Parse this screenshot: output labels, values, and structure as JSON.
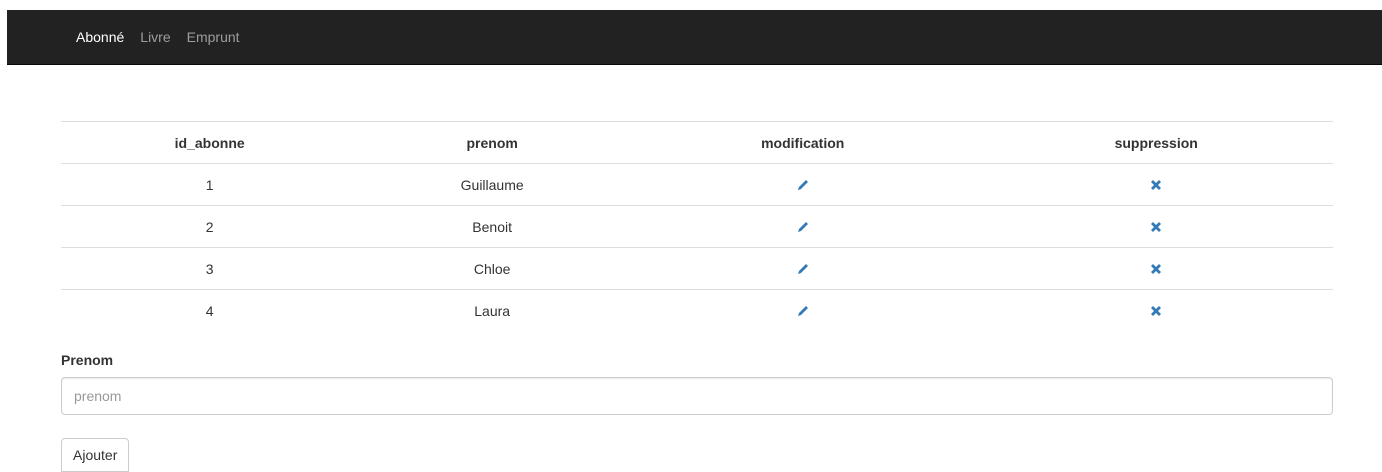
{
  "navbar": {
    "items": [
      {
        "label": "Abonné",
        "active": true
      },
      {
        "label": "Livre",
        "active": false
      },
      {
        "label": "Emprunt",
        "active": false
      }
    ]
  },
  "table": {
    "headers": [
      "id_abonne",
      "prenom",
      "modification",
      "suppression"
    ],
    "rows": [
      {
        "id": "1",
        "prenom": "Guillaume",
        "edit_icon": "pencil-icon",
        "delete_icon": "remove-icon"
      },
      {
        "id": "2",
        "prenom": "Benoit",
        "edit_icon": "pencil-icon",
        "delete_icon": "remove-icon"
      },
      {
        "id": "3",
        "prenom": "Chloe",
        "edit_icon": "pencil-icon",
        "delete_icon": "remove-icon"
      },
      {
        "id": "4",
        "prenom": "Laura",
        "edit_icon": "pencil-icon",
        "delete_icon": "remove-icon"
      }
    ]
  },
  "form": {
    "label": "Prenom",
    "placeholder": "prenom",
    "value": "",
    "submit_label": "Ajouter"
  },
  "colors": {
    "navbar_bg": "#222222",
    "nav_active": "#ffffff",
    "nav_inactive": "#9d9d9d",
    "icon_blue": "#337ab7"
  }
}
